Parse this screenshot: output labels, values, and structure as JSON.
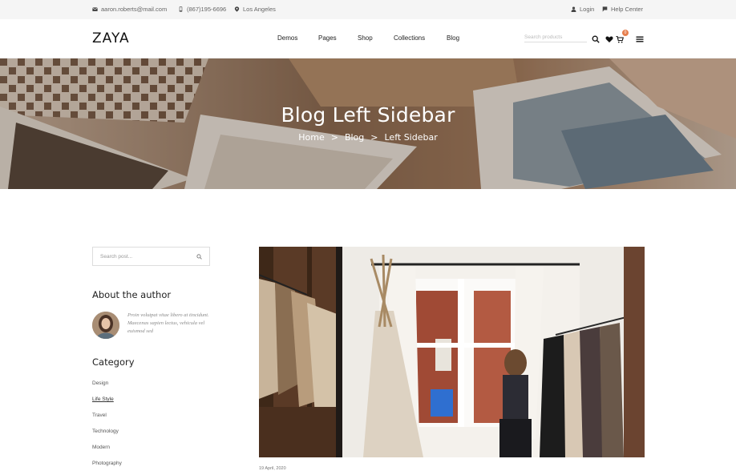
{
  "topbar": {
    "email": "aaron.roberts@mail.com",
    "phone": "(867)195-6696",
    "location": "Los Angeles",
    "login": "Login",
    "help": "Help Center",
    "icons": [
      "mail-icon",
      "phone-icon",
      "location-pin-icon",
      "user-icon",
      "flag-icon"
    ]
  },
  "header": {
    "logo": "ZAYA",
    "nav": [
      "Demos",
      "Pages",
      "Shop",
      "Collections",
      "Blog"
    ],
    "search_placeholder": "Search products",
    "cart_count": "0",
    "accent_color": "#e67e4d",
    "icons": [
      "search-icon",
      "heart-icon",
      "cart-icon",
      "menu-icon"
    ]
  },
  "banner": {
    "title": "Blog Left Sidebar",
    "breadcrumb": [
      "Home",
      "Blog",
      "Left Sidebar"
    ],
    "separator": ">"
  },
  "sidebar": {
    "search_placeholder": "Search post...",
    "about_title": "About the author",
    "about_text": "Proin volutpat vitae libero at tincidunt. Maecenas sapien lectus, vehicula vel euismod sed",
    "category_title": "Category",
    "categories": [
      "Design",
      "Life Style",
      "Travel",
      "Technology",
      "Modern",
      "Photography"
    ],
    "active_category": "Life Style"
  },
  "post": {
    "date": "19 April, 2020"
  }
}
